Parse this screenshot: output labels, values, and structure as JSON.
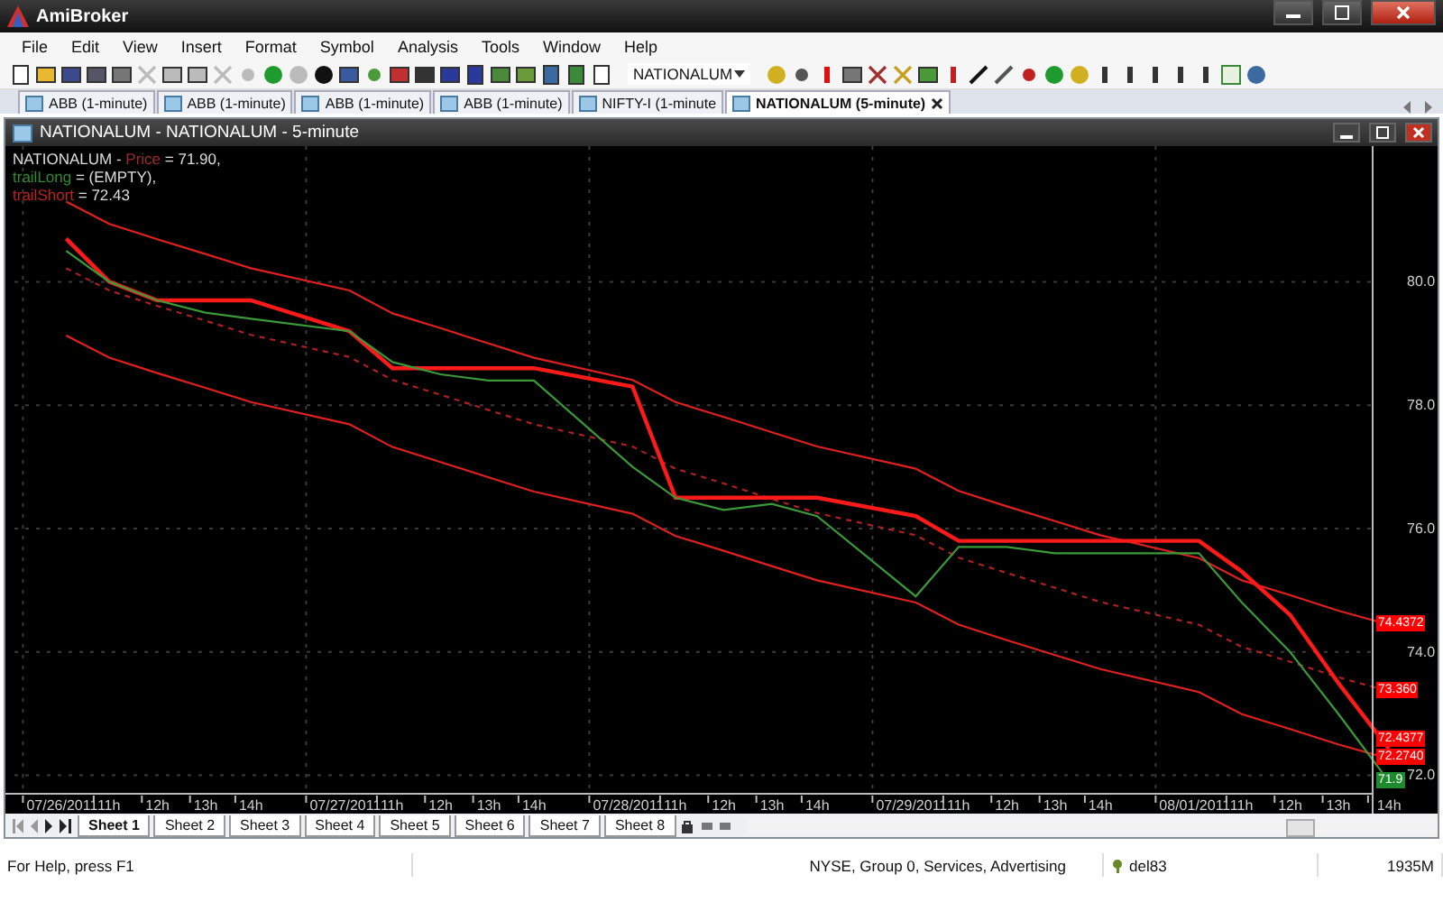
{
  "window": {
    "title": "AmiBroker"
  },
  "menu": [
    "File",
    "Edit",
    "View",
    "Insert",
    "Format",
    "Symbol",
    "Analysis",
    "Tools",
    "Window",
    "Help"
  ],
  "toolbar": {
    "symbol": "NATIONALUM"
  },
  "doc_tabs": [
    {
      "label": "ABB (1-minute)",
      "selected": false
    },
    {
      "label": "ABB (1-minute)",
      "selected": false
    },
    {
      "label": "ABB (1-minute)",
      "selected": false
    },
    {
      "label": "ABB (1-minute)",
      "selected": false
    },
    {
      "label": "NIFTY-I (1-minute",
      "selected": false
    },
    {
      "label": "NATIONALUM (5-minute)",
      "selected": true
    }
  ],
  "chart_window": {
    "title": "NATIONALUM - NATIONALUM - 5-minute",
    "legend": [
      {
        "prefix": "NATIONALUM - ",
        "name": "Price",
        "color": "#9b2a2a",
        "suffix": " = 71.90,"
      },
      {
        "name": "trailLong",
        "color": "#2e8b2e",
        "suffix": " = (EMPTY),"
      },
      {
        "name": "trailShort",
        "color": "#c02020",
        "suffix": " = 72.43"
      }
    ],
    "chart_data": {
      "type": "line",
      "ylim": [
        71.7,
        82.2
      ],
      "grid": true,
      "categories": [
        "07/26/2011",
        "11h",
        "12h",
        "13h",
        "14h",
        "07/27/2011",
        "11h",
        "12h",
        "13h",
        "14h",
        "07/28/2011",
        "11h",
        "12h",
        "13h",
        "14h",
        "07/29/2011",
        "11h",
        "12h",
        "13h",
        "14h",
        "08/01/2011",
        "11h",
        "12h",
        "13h",
        "14h"
      ],
      "series": [
        {
          "color": "#e02020",
          "values": [
            81.3,
            80.94,
            80.69,
            80.45,
            80.22,
            79.86,
            79.49,
            79.25,
            79.0,
            78.77,
            78.41,
            78.05,
            77.81,
            77.56,
            77.33,
            76.97,
            76.61,
            76.36,
            76.12,
            75.89,
            75.52,
            75.16,
            74.92,
            74.67,
            74.44
          ]
        },
        {
          "color": "#b02020",
          "line_style": "dashed",
          "values": [
            80.22,
            79.86,
            79.61,
            79.37,
            79.14,
            78.78,
            78.41,
            78.17,
            77.92,
            77.69,
            77.33,
            76.97,
            76.73,
            76.48,
            76.25,
            75.89,
            75.53,
            75.28,
            75.04,
            74.81,
            74.44,
            74.08,
            73.84,
            73.59,
            73.36
          ]
        },
        {
          "color": "#e02020",
          "values": [
            79.13,
            78.77,
            78.52,
            78.28,
            78.05,
            77.69,
            77.32,
            77.08,
            76.83,
            76.6,
            76.24,
            75.88,
            75.64,
            75.39,
            75.16,
            74.8,
            74.44,
            74.19,
            73.95,
            73.72,
            73.35,
            72.99,
            72.75,
            72.5,
            72.27
          ]
        },
        {
          "color": "#ff1a1a",
          "values": [
            80.7,
            80.0,
            79.7,
            79.7,
            79.7,
            79.2,
            78.6,
            78.6,
            78.6,
            78.6,
            78.3,
            76.5,
            76.5,
            76.5,
            76.5,
            76.2,
            75.8,
            75.8,
            75.8,
            75.8,
            75.8,
            75.3,
            74.6,
            73.5,
            72.43
          ]
        },
        {
          "color": "#3a9a3a",
          "values": [
            80.5,
            80.0,
            79.7,
            79.5,
            79.4,
            79.2,
            78.7,
            78.5,
            78.4,
            78.4,
            77.0,
            76.5,
            76.3,
            76.4,
            76.2,
            74.9,
            75.7,
            75.7,
            75.6,
            75.6,
            75.6,
            74.8,
            74.0,
            73.0,
            71.9
          ]
        }
      ],
      "yticks": [
        {
          "value": 72,
          "label": "72.0"
        },
        {
          "value": 74,
          "label": "74.0"
        },
        {
          "value": 76,
          "label": "76.0"
        },
        {
          "value": 78,
          "label": "78.0"
        },
        {
          "value": 80,
          "label": "80.0"
        }
      ]
    },
    "price_badges": [
      {
        "label": "74.4372",
        "color": "#ff0000"
      },
      {
        "label": "73.360",
        "color": "#ff0000"
      },
      {
        "label": "72.4377",
        "color": "#ff0000"
      },
      {
        "label": "72.2740",
        "color": "#ff0000"
      },
      {
        "label": "71.9",
        "color": "#1e8a2e"
      }
    ]
  },
  "sheet_tabs": [
    {
      "label": "Sheet 1",
      "selected": true
    },
    {
      "label": "Sheet 2",
      "selected": false
    },
    {
      "label": "Sheet 3",
      "selected": false
    },
    {
      "label": "Sheet 4",
      "selected": false
    },
    {
      "label": "Sheet 5",
      "selected": false
    },
    {
      "label": "Sheet 6",
      "selected": false
    },
    {
      "label": "Sheet 7",
      "selected": false
    },
    {
      "label": "Sheet 8",
      "selected": false
    }
  ],
  "status_bar": {
    "help": "For Help, press F1",
    "info": "NYSE, Group 0, Services, Advertising",
    "user": "del83",
    "memory": "1935M"
  }
}
